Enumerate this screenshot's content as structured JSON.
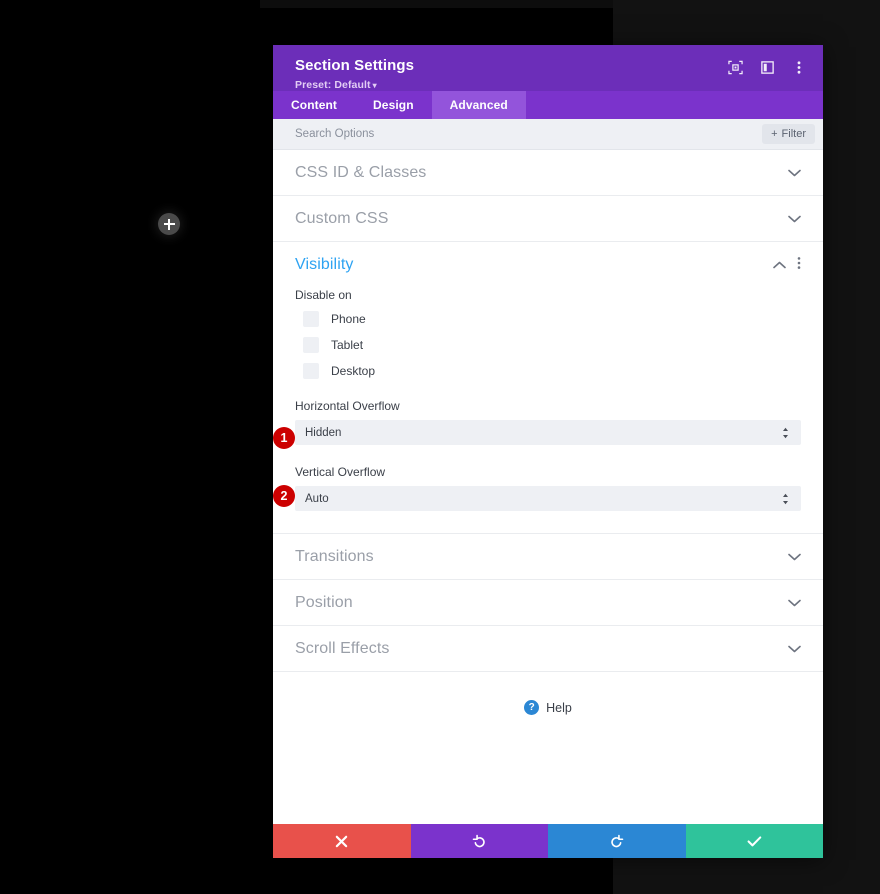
{
  "canvas": {
    "add_module_icon": "plus-icon",
    "background_color": "#000000",
    "right_pane_color": "#121212"
  },
  "modal": {
    "title": "Section Settings",
    "preset_label": "Preset: Default",
    "preset_caret": "▾",
    "header_color": "#6c2eb9",
    "header_icons": [
      {
        "name": "focus-expand-icon"
      },
      {
        "name": "split-view-icon"
      },
      {
        "name": "more-options-icon"
      }
    ],
    "tabs": [
      {
        "label": "Content",
        "active": false
      },
      {
        "label": "Design",
        "active": false
      },
      {
        "label": "Advanced",
        "active": true
      }
    ],
    "search": {
      "placeholder": "Search Options",
      "value": ""
    },
    "filter_button": {
      "label": "Filter",
      "plus": "+"
    },
    "sections": [
      {
        "title": "CSS ID & Classes",
        "state": "collapsed",
        "chevron": "⌄"
      },
      {
        "title": "Custom CSS",
        "state": "collapsed",
        "chevron": "⌄"
      }
    ],
    "visibility": {
      "title": "Visibility",
      "accent_color": "#2ea3f2",
      "chevron_up": "⌃",
      "more_icon": "more-options-icon",
      "disable_on_label": "Disable on",
      "devices": [
        {
          "label": "Phone",
          "checked": false
        },
        {
          "label": "Tablet",
          "checked": false
        },
        {
          "label": "Desktop",
          "checked": false
        }
      ],
      "horizontal_overflow": {
        "label": "Horizontal Overflow",
        "value": "Hidden",
        "badge": "1"
      },
      "vertical_overflow": {
        "label": "Vertical Overflow",
        "value": "Auto",
        "badge": "2"
      }
    },
    "sections_bottom": [
      {
        "title": "Transitions",
        "state": "collapsed",
        "chevron": "⌄"
      },
      {
        "title": "Position",
        "state": "collapsed",
        "chevron": "⌄"
      },
      {
        "title": "Scroll Effects",
        "state": "collapsed",
        "chevron": "⌄"
      }
    ],
    "help": {
      "label": "Help",
      "icon": "question-mark-icon",
      "icon_glyph": "?"
    },
    "footer_buttons": [
      {
        "name": "cancel-button",
        "icon": "close-x-icon",
        "color": "#e8514b"
      },
      {
        "name": "undo-button",
        "icon": "undo-arrow-icon",
        "color": "#7b33cc"
      },
      {
        "name": "redo-button",
        "icon": "redo-arrow-icon",
        "color": "#2b87d4"
      },
      {
        "name": "save-button",
        "icon": "checkmark-icon",
        "color": "#2fc39b"
      }
    ]
  },
  "annotations": {
    "badge_color": "#cc0000",
    "badge_1": "1",
    "badge_2": "2"
  }
}
